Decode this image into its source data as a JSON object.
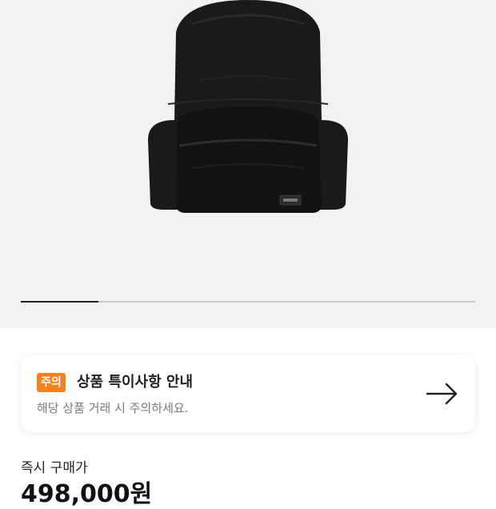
{
  "product": {
    "image_name": "black-backpack-image",
    "gallery_progress": 0.17
  },
  "notice": {
    "badge": "주의",
    "title": "상품 특이사항 안내",
    "subtitle": "해당 상품 거래 시 주의하세요.",
    "arrow_icon": "arrow-right-icon",
    "badge_color": "#f58220"
  },
  "price": {
    "label": "즉시 구매가",
    "value": "498,000원"
  }
}
